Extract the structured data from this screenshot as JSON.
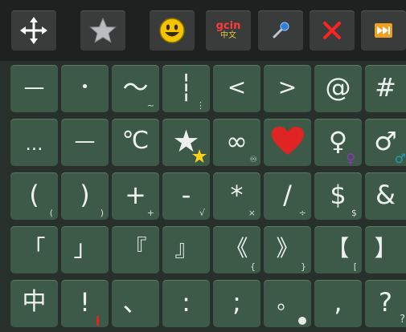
{
  "toolbar": {
    "gcin_label": "gcin",
    "gcin_sub": "中文"
  },
  "keys": {
    "r0": [
      {
        "main": "—",
        "sub": ""
      },
      {
        "main": "•",
        "sub": ""
      },
      {
        "main": "〜",
        "sub": "~"
      },
      {
        "main": "┆",
        "sub": "⋮"
      },
      {
        "main": "<",
        "sub": ""
      },
      {
        "main": ">",
        "sub": ""
      },
      {
        "main": "@",
        "sub": ""
      },
      {
        "main": "#",
        "sub": ""
      }
    ],
    "r1": [
      {
        "main": "…",
        "sub": ""
      },
      {
        "main": "—",
        "sub": ""
      },
      {
        "main": "℃",
        "sub": ""
      },
      {
        "main": "★",
        "sub": ""
      },
      {
        "main": "∞",
        "sub": "♾"
      },
      {
        "main": "❤",
        "sub": ""
      },
      {
        "main": "♀",
        "sub": "♀"
      },
      {
        "main": "♂",
        "sub": "♂"
      }
    ],
    "r2": [
      {
        "main": "(",
        "sub": "("
      },
      {
        "main": ")",
        "sub": ")"
      },
      {
        "main": "+",
        "sub": "+"
      },
      {
        "main": "-",
        "sub": "√"
      },
      {
        "main": "*",
        "sub": "×"
      },
      {
        "main": "/",
        "sub": "÷"
      },
      {
        "main": "$",
        "sub": "$"
      },
      {
        "main": "&",
        "sub": ""
      }
    ],
    "r3": [
      {
        "main": "「",
        "sub": ""
      },
      {
        "main": "」",
        "sub": ""
      },
      {
        "main": "『",
        "sub": ""
      },
      {
        "main": "』",
        "sub": ""
      },
      {
        "main": "《",
        "sub": "{"
      },
      {
        "main": "》",
        "sub": "}"
      },
      {
        "main": "【",
        "sub": "["
      },
      {
        "main": "】",
        "sub": ""
      }
    ],
    "r4": [
      {
        "main": "中",
        "sub": ""
      },
      {
        "main": "!",
        "sub": ""
      },
      {
        "main": "、",
        "sub": ""
      },
      {
        "main": ":",
        "sub": ""
      },
      {
        "main": ";",
        "sub": ""
      },
      {
        "main": "。",
        "sub": ""
      },
      {
        "main": ",",
        "sub": ""
      },
      {
        "main": "?",
        "sub": "?"
      }
    ]
  },
  "colors": {
    "key_bg": "#3d5a48",
    "heart": "#e02424",
    "female_sub": "#9b2fc4",
    "male_sub": "#1aa3b0",
    "exclaim_sub": "#e02424",
    "close": "#ff2222"
  },
  "icons": [
    "move-arrows-icon",
    "star-icon",
    "smiley-icon",
    "gcin-icon",
    "microphone-icon",
    "close-icon",
    "fast-forward-icon"
  ]
}
